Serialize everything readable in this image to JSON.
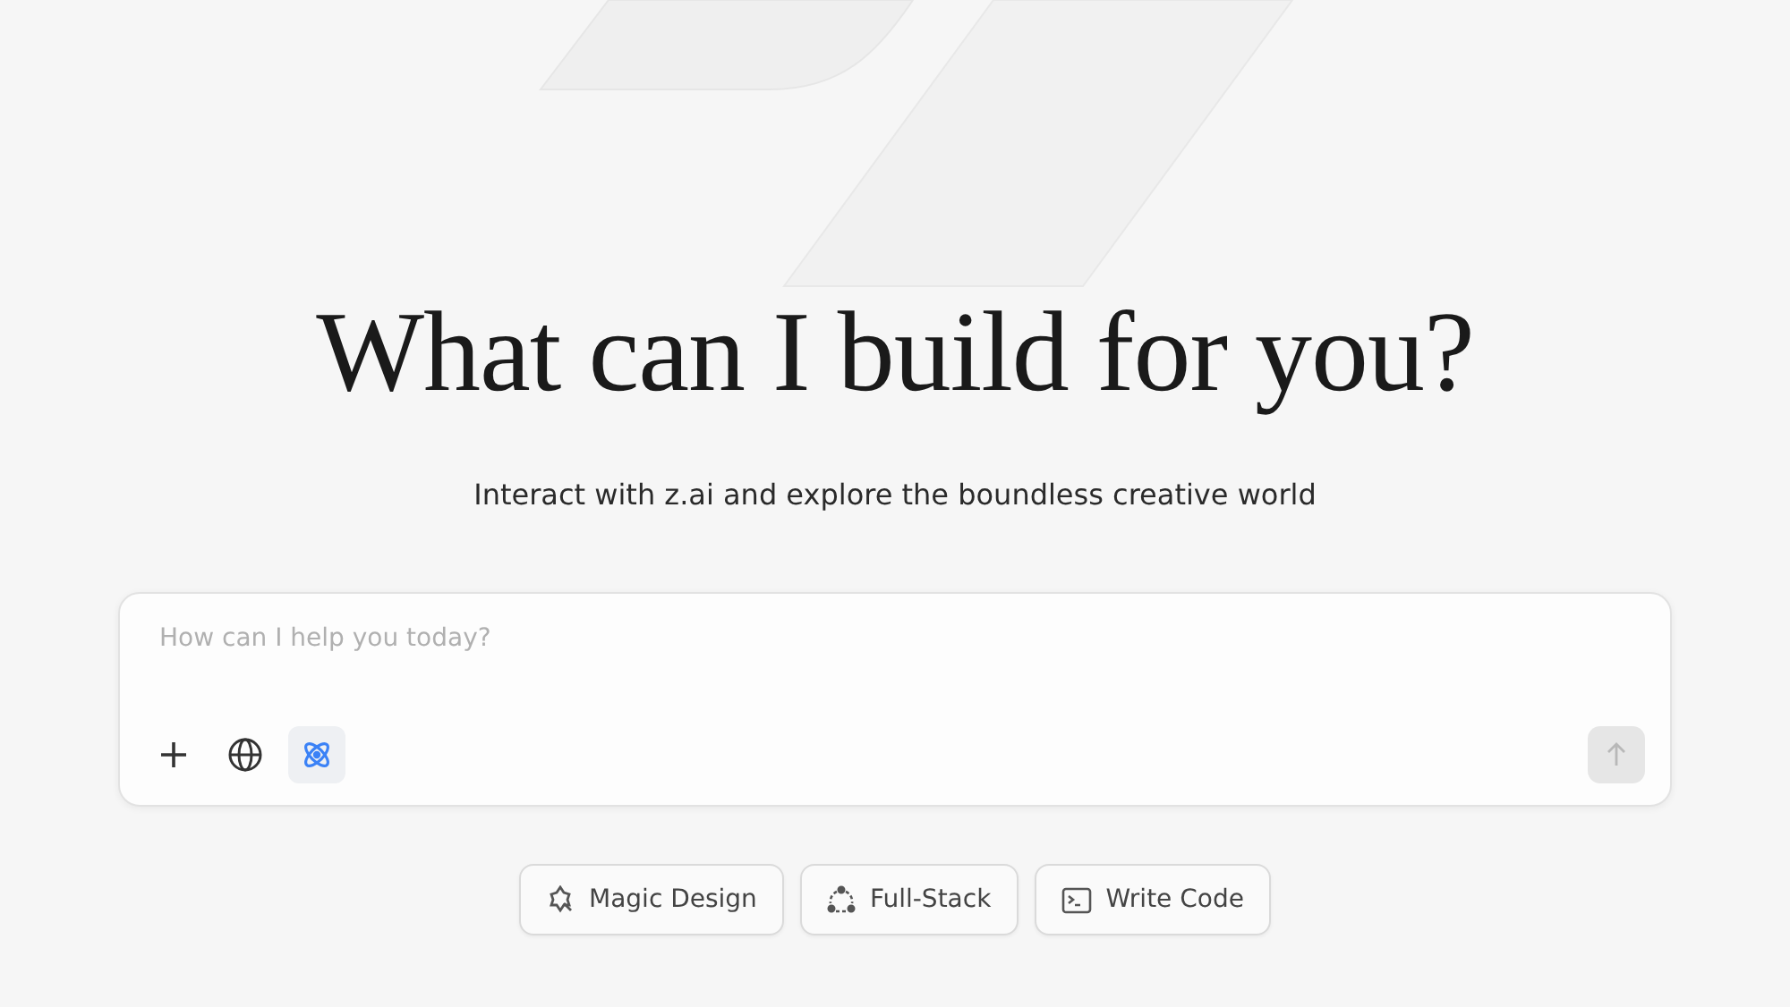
{
  "headline": "What can I build for you?",
  "subtitle": "Interact with z.ai and explore the boundless creative world",
  "prompt": {
    "placeholder": "How can I help you today?",
    "tools": [
      {
        "kind": "plus",
        "selected": false
      },
      {
        "kind": "globe",
        "selected": false
      },
      {
        "kind": "atom",
        "selected": true
      }
    ],
    "send_disabled": true
  },
  "suggestions": [
    {
      "kind": "magic",
      "label": "Magic Design"
    },
    {
      "kind": "stack",
      "label": "Full-Stack"
    },
    {
      "kind": "terminal",
      "label": "Write Code"
    }
  ]
}
